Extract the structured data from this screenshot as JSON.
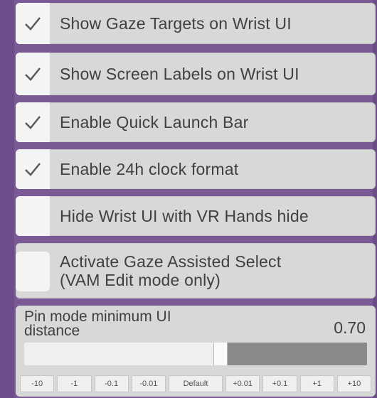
{
  "toggles": [
    {
      "label": "Show Gaze Targets on Wrist UI",
      "checked": true
    },
    {
      "label": "Show Screen Labels on Wrist UI",
      "checked": true
    },
    {
      "label": "Enable Quick Launch Bar",
      "checked": true
    },
    {
      "label": "Enable 24h clock format",
      "checked": true
    },
    {
      "label": "Hide Wrist UI with VR Hands hide",
      "checked": false
    },
    {
      "label": "Activate Gaze Assisted Select\n(VAM Edit mode only)",
      "checked": false
    }
  ],
  "slider": {
    "label": "Pin mode minimum UI\ndistance",
    "value_text": "0.70",
    "fill_fraction": 0.57,
    "steps": [
      "-10",
      "-1",
      "-0.1",
      "-0.01",
      "Default",
      "+0.01",
      "+0.1",
      "+1",
      "+10"
    ]
  },
  "icons": {
    "checkmark": "checkmark-icon"
  },
  "colors": {
    "background": "#7a5a95",
    "panel": "#d8d8d8",
    "checkbox": "#f4f4f4",
    "text": "#404040",
    "track": "#8a8a8a"
  }
}
